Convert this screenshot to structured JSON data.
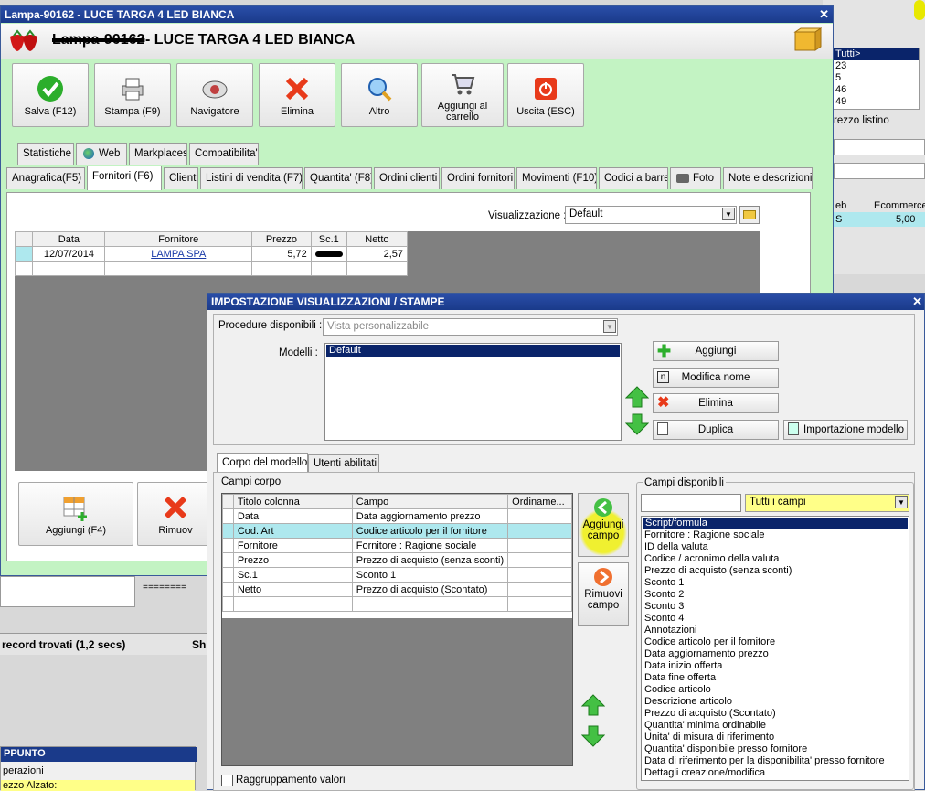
{
  "main_window": {
    "title": "Lampa-90162 - LUCE TARGA 4 LED BIANCA",
    "header": "- LUCE TARGA 4 LED BIANCA",
    "header_scribble": "Lampa-90162"
  },
  "toolbar": [
    {
      "label1": "Salva (F12)",
      "label2": "",
      "icon": "check-icon"
    },
    {
      "label1": "Stampa (F9)",
      "label2": "",
      "icon": "printer-icon"
    },
    {
      "label1": "Navigatore",
      "label2": "",
      "icon": "navigator-icon"
    },
    {
      "label1": "Elimina",
      "label2": "",
      "icon": "red-x-icon"
    },
    {
      "label1": "Altro",
      "label2": "",
      "icon": "magnifier-icon"
    },
    {
      "label1": "Aggiungi al",
      "label2": "carrello",
      "icon": "cart-icon"
    },
    {
      "label1": "Uscita (ESC)",
      "label2": "",
      "icon": "exit-icon"
    }
  ],
  "tabs_top": [
    "Statistiche",
    "Web",
    "Markplaces",
    "Compatibilita'"
  ],
  "tabs_main": [
    "Anagrafica(F5)",
    "Fornitori (F6)",
    "Clienti",
    "Listini di vendita (F7)",
    "Quantita' (F8)",
    "Ordini clienti",
    "Ordini fornitori",
    "Movimenti (F10)",
    "Codici a barre",
    "Foto",
    "Note e descrizioni"
  ],
  "visualizzazione": {
    "label": "Visualizzazione :",
    "value": "Default"
  },
  "suppliers_table": {
    "headers": [
      "Data",
      "Fornitore",
      "Prezzo",
      "Sc.1",
      "Netto"
    ],
    "row": {
      "data": "12/07/2014",
      "fornitore": "LAMPA SPA",
      "prezzo": "5,72",
      "netto": "2,57"
    }
  },
  "bottom_buttons": {
    "add": "Aggiungi (F4)",
    "remove": "Rimuov"
  },
  "bg": {
    "tutti": "Tutti>",
    "nums": [
      "23",
      "5",
      "46",
      "49"
    ],
    "prezzo_listino": "rezzo listino",
    "col_eb": "eb",
    "col_ecommerce": "Ecommerce",
    "val_s": "S",
    "val_ecom": "5,00",
    "records": "record trovati (1,2 secs)",
    "sh": "Sh",
    "appunto": "PPUNTO",
    "operazioni": "perazioni",
    "prezzo_alzato": "ezzo Alzato:",
    "dashes": "========"
  },
  "dialog": {
    "title": "IMPOSTAZIONE VISUALIZZAZIONI / STAMPE",
    "procedure_label": "Procedure disponibili :",
    "procedure_value": "Vista personalizzabile",
    "modelli_label": "Modelli :",
    "modelli": [
      "Default"
    ],
    "buttons": {
      "aggiungi": "Aggiungi",
      "modifica": "Modifica nome",
      "elimina": "Elimina",
      "duplica": "Duplica",
      "importa": "Importazione modello"
    },
    "tabs": [
      "Corpo del modello",
      "Utenti abilitati"
    ],
    "campi_corpo_label": "Campi corpo",
    "campi_headers": [
      "Titolo colonna",
      "Campo",
      "Ordiname..."
    ],
    "campi_rows": [
      {
        "titolo": "Data",
        "campo": "Data aggiornamento prezzo"
      },
      {
        "titolo": "Cod. Art",
        "campo": "Codice articolo per il fornitore"
      },
      {
        "titolo": "Fornitore",
        "campo": "Fornitore : Ragione sociale"
      },
      {
        "titolo": "Prezzo",
        "campo": "Prezzo di acquisto (senza sconti)"
      },
      {
        "titolo": "Sc.1",
        "campo": "Sconto 1"
      },
      {
        "titolo": "Netto",
        "campo": "Prezzo di acquisto (Scontato)"
      }
    ],
    "aggiungi_campo": [
      "Aggiungi",
      "campo"
    ],
    "rimuovi_campo": [
      "Rimuovi",
      "campo"
    ],
    "raggruppamento": "Raggruppamento valori",
    "campi_disponibili_label": "Campi disponibili",
    "filter_value": "Tutti i campi",
    "campi_disponibili": [
      "Script/formula",
      "Fornitore : Ragione sociale",
      "ID della valuta",
      "Codice / acronimo della valuta",
      "Prezzo di acquisto (senza sconti)",
      "Sconto 1",
      "Sconto 2",
      "Sconto 3",
      "Sconto 4",
      "Annotazioni",
      "Codice articolo per il fornitore",
      "Data aggiornamento prezzo",
      "Data inizio offerta",
      "Data fine offerta",
      "Codice articolo",
      "Descrizione articolo",
      "Prezzo di acquisto (Scontato)",
      "Quantita' minima ordinabile",
      "Unita' di misura di riferimento",
      "Quantita' disponibile presso fornitore",
      "Data di riferimento per la disponibilita' presso fornitore",
      "Dettagli creazione/modifica"
    ]
  },
  "colors": {
    "title_bar": "#1a3a8a",
    "window_bg": "#c3f3c3",
    "selection": "#0a246a",
    "highlight_row": "#aee8ee",
    "yellow": "#ffff88"
  }
}
